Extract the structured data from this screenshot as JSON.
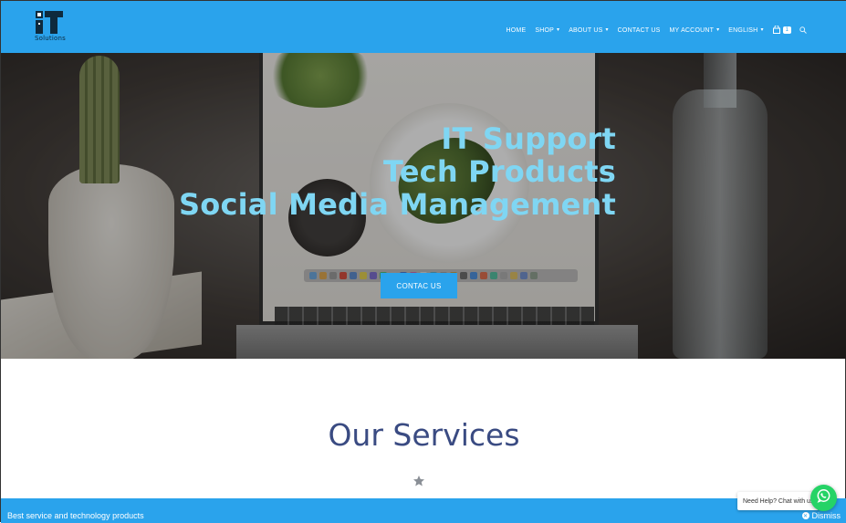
{
  "brand": {
    "logo_word": "Solutions"
  },
  "nav": {
    "items": [
      {
        "label": "HOME",
        "has_dropdown": false
      },
      {
        "label": "SHOP",
        "has_dropdown": true
      },
      {
        "label": "ABOUT US",
        "has_dropdown": true
      },
      {
        "label": "CONTACT US",
        "has_dropdown": false
      },
      {
        "label": "MY ACCOUNT",
        "has_dropdown": true
      },
      {
        "label": "ENGLISH",
        "has_dropdown": true
      }
    ],
    "cart_count": "1",
    "icons": {
      "cart": "shopping-bag-icon",
      "search": "search-icon"
    }
  },
  "hero": {
    "headline": [
      "IT Support",
      "Tech Products",
      "Social Media Management"
    ],
    "cta_label": "CONTAC US",
    "headline_color": "#7fd6f3"
  },
  "services": {
    "title": "Our Services",
    "divider_icon": "star-icon"
  },
  "notice": {
    "text": "Best service and technology products",
    "dismiss_label": "Dismiss"
  },
  "chat": {
    "label": "Need Help? Chat with us",
    "icon": "whatsapp-icon"
  },
  "colors": {
    "accent": "#2aa3ec",
    "title": "#3a4b82",
    "whatsapp": "#25d366"
  }
}
